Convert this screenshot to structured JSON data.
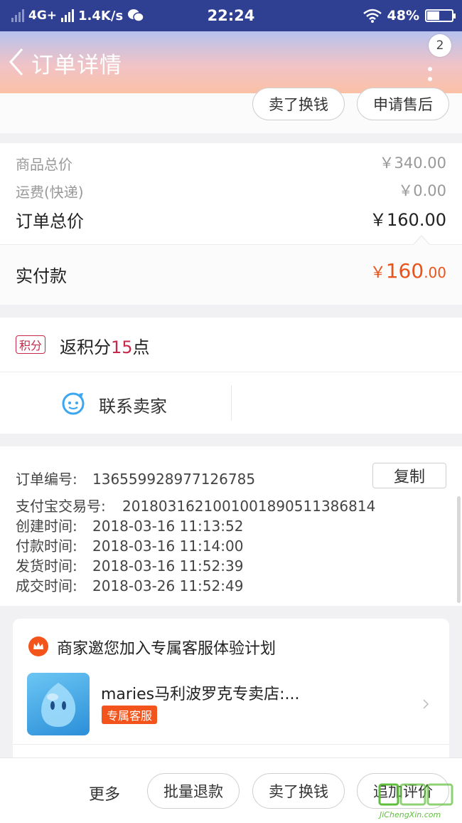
{
  "status_bar": {
    "network": "4G+",
    "speed": "1.4K/s",
    "time": "22:24",
    "battery": "48%"
  },
  "header": {
    "title": "订单详情",
    "badge_count": "2"
  },
  "top_actions": {
    "sell_label": "卖了换钱",
    "aftersale_label": "申请售后"
  },
  "price_summary": {
    "goods_total_label": "商品总价",
    "goods_total_value": "￥340.00",
    "shipping_label": "运费(快递)",
    "shipping_value": "￥0.00",
    "order_total_label": "订单总价",
    "order_total_value": "￥160.00",
    "paid_label": "实付款",
    "paid_currency": "￥",
    "paid_integer": "160",
    "paid_decimal": ".00"
  },
  "points": {
    "tag": "积分",
    "text_prefix": "返积分",
    "amount": "15",
    "text_suffix": "点"
  },
  "contact": {
    "label": "联系卖家"
  },
  "order_info": {
    "copy_label": "复制",
    "rows": [
      {
        "key": "订单编号:",
        "value": "136559928977126785"
      },
      {
        "key": "支付宝交易号:",
        "value": "2018031621001001890511386814"
      },
      {
        "key": "创建时间:",
        "value": "2018-03-16 11:13:52"
      },
      {
        "key": "付款时间:",
        "value": "2018-03-16 11:14:00"
      },
      {
        "key": "发货时间:",
        "value": "2018-03-16 11:52:39"
      },
      {
        "key": "成交时间:",
        "value": "2018-03-26 11:52:49"
      }
    ]
  },
  "service_card": {
    "title": "商家邀您加入专属客服体验计划",
    "shop_name": "maries马利波罗克专卖店:...",
    "tag": "专属客服"
  },
  "bottom_bar": {
    "more_label": "更多",
    "batch_refund_label": "批量退款",
    "sell_label": "卖了换钱",
    "review_label": "追加评价"
  },
  "watermark": {
    "text": "JiChengXin.com"
  },
  "colors": {
    "status_bar": "#2f3f92",
    "price_accent": "#e8541b",
    "points_accent": "#c8294a",
    "service_tag": "#f2541b",
    "contact_icon": "#3ca6f0"
  }
}
